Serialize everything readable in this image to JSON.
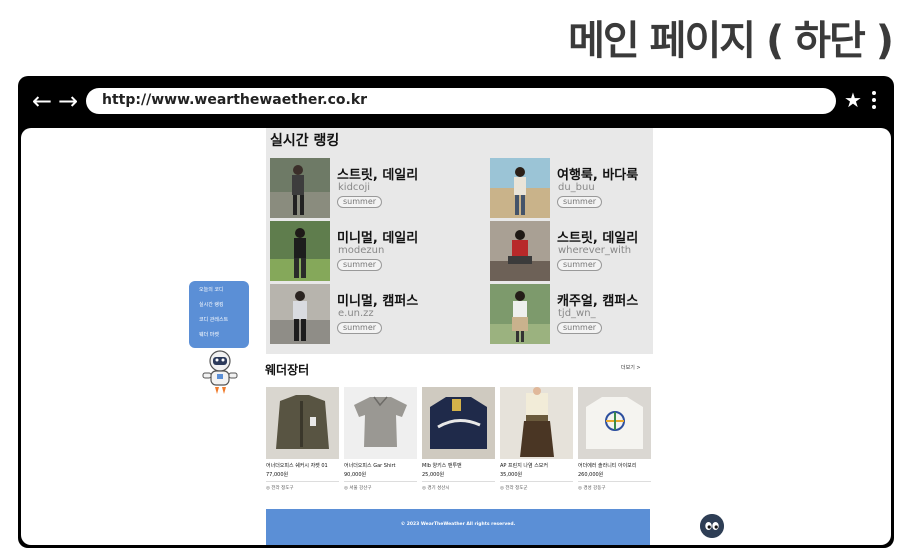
{
  "slide_title": "메인 페이지 ( 하단 )",
  "browser": {
    "back_label": "←",
    "forward_label": "→",
    "url": "http://www.wearthewaether.co.kr",
    "bookmark_label": "★"
  },
  "ranking": {
    "title": "실시간 랭킹",
    "items": [
      {
        "style": "스트릿, 데일리",
        "user": "kidcoji",
        "tag": "summer"
      },
      {
        "style": "여행룩, 바다룩",
        "user": "du_buu",
        "tag": "summer"
      },
      {
        "style": "미니멀, 데일리",
        "user": "modezun",
        "tag": "summer"
      },
      {
        "style": "스트릿, 데일리",
        "user": "wherever_with",
        "tag": "summer"
      },
      {
        "style": "미니멀, 캠퍼스",
        "user": "e.un.zz",
        "tag": "summer"
      },
      {
        "style": "캐주얼, 캠퍼스",
        "user": "tjd_wn_",
        "tag": "summer"
      }
    ]
  },
  "side_menu": {
    "items": [
      "오늘의 코디",
      "실시간 랭킹",
      "코디 관레스트",
      "웨더 마켓"
    ]
  },
  "market": {
    "title": "웨더장터",
    "more_label": "더보기 >",
    "products": [
      {
        "name": "어너더오피스 쉐커시 자켓 01",
        "price": "77,000원",
        "location": "◎ 전라 정도구"
      },
      {
        "name": "어너더오피스 Gar Shirt",
        "price": "90,000원",
        "location": "◎ 서울 강산구"
      },
      {
        "name": "Mlb 양키스 맨투맨",
        "price": "25,000원",
        "location": "◎ 경기 성산시"
      },
      {
        "name": "AP 프린지 나염 스모커",
        "price": "35,000원",
        "location": "◎ 전라 정도군"
      },
      {
        "name": "어더에러 솔라니티 아이보리",
        "price": "260,000원",
        "location": "◎ 경성 강동구"
      }
    ]
  },
  "footer": {
    "copyright": "© 2023 WearTheWeather All rights reserved."
  },
  "colors": {
    "accent": "#5b8fd6",
    "browser_frame": "#000000",
    "ranking_bg": "#e8e8e8"
  }
}
